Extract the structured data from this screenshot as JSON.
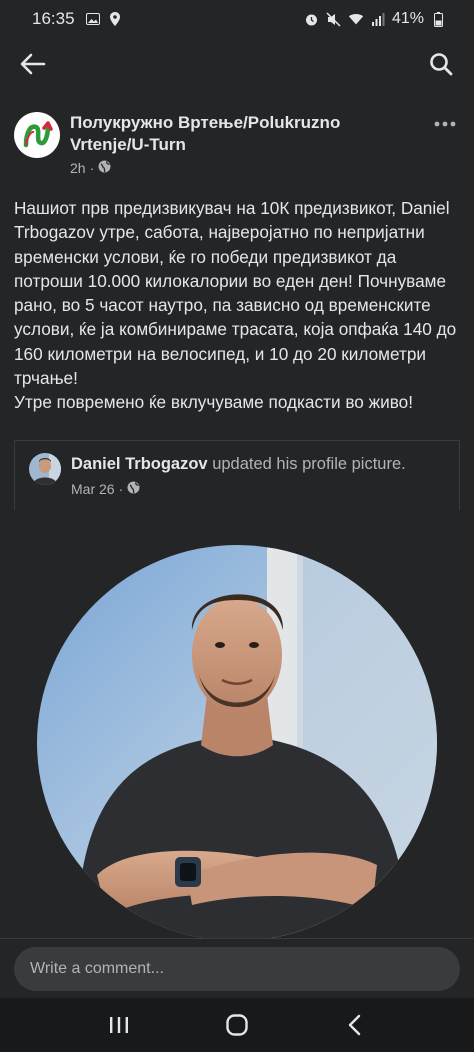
{
  "status": {
    "time": "16:35",
    "battery": "41%"
  },
  "post": {
    "page_name": "Полукружно Вртење/Polukruzno Vrtenje/U-Turn",
    "time_ago": "2h",
    "body": "Нашиот прв предизвикувач на 10К предизвикот, Daniel Trbogazov  утре, сабота, најверојатно по непријатни временски услови, ќе го победи предизвикот да потроши 10.000 килокалории во еден ден! Почнуваме рано, во 5 часот наутро, па зависно од временските услови, ќе ја комбинираме трасата, која опфаќа 140 до 160 километри на велосипед, и 10 до 20 километри трчање!\nУтре повремено ќе вклучуваме подкасти во живо!"
  },
  "shared": {
    "name": "Daniel Trbogazov",
    "action": "updated his profile picture.",
    "date": "Mar 26"
  },
  "comment": {
    "placeholder": "Write a comment..."
  },
  "icons": {
    "back": "arrow-left-icon",
    "search": "search-icon",
    "more": "more-dots-icon",
    "globe": "globe-icon",
    "nav_recents": "recents-icon",
    "nav_home": "home-icon",
    "nav_back": "chevron-left-icon"
  },
  "colors": {
    "background": "#242526",
    "text_primary": "#e4e6eb",
    "text_secondary": "#b0b3b8",
    "input_bg": "#3a3b3c"
  }
}
